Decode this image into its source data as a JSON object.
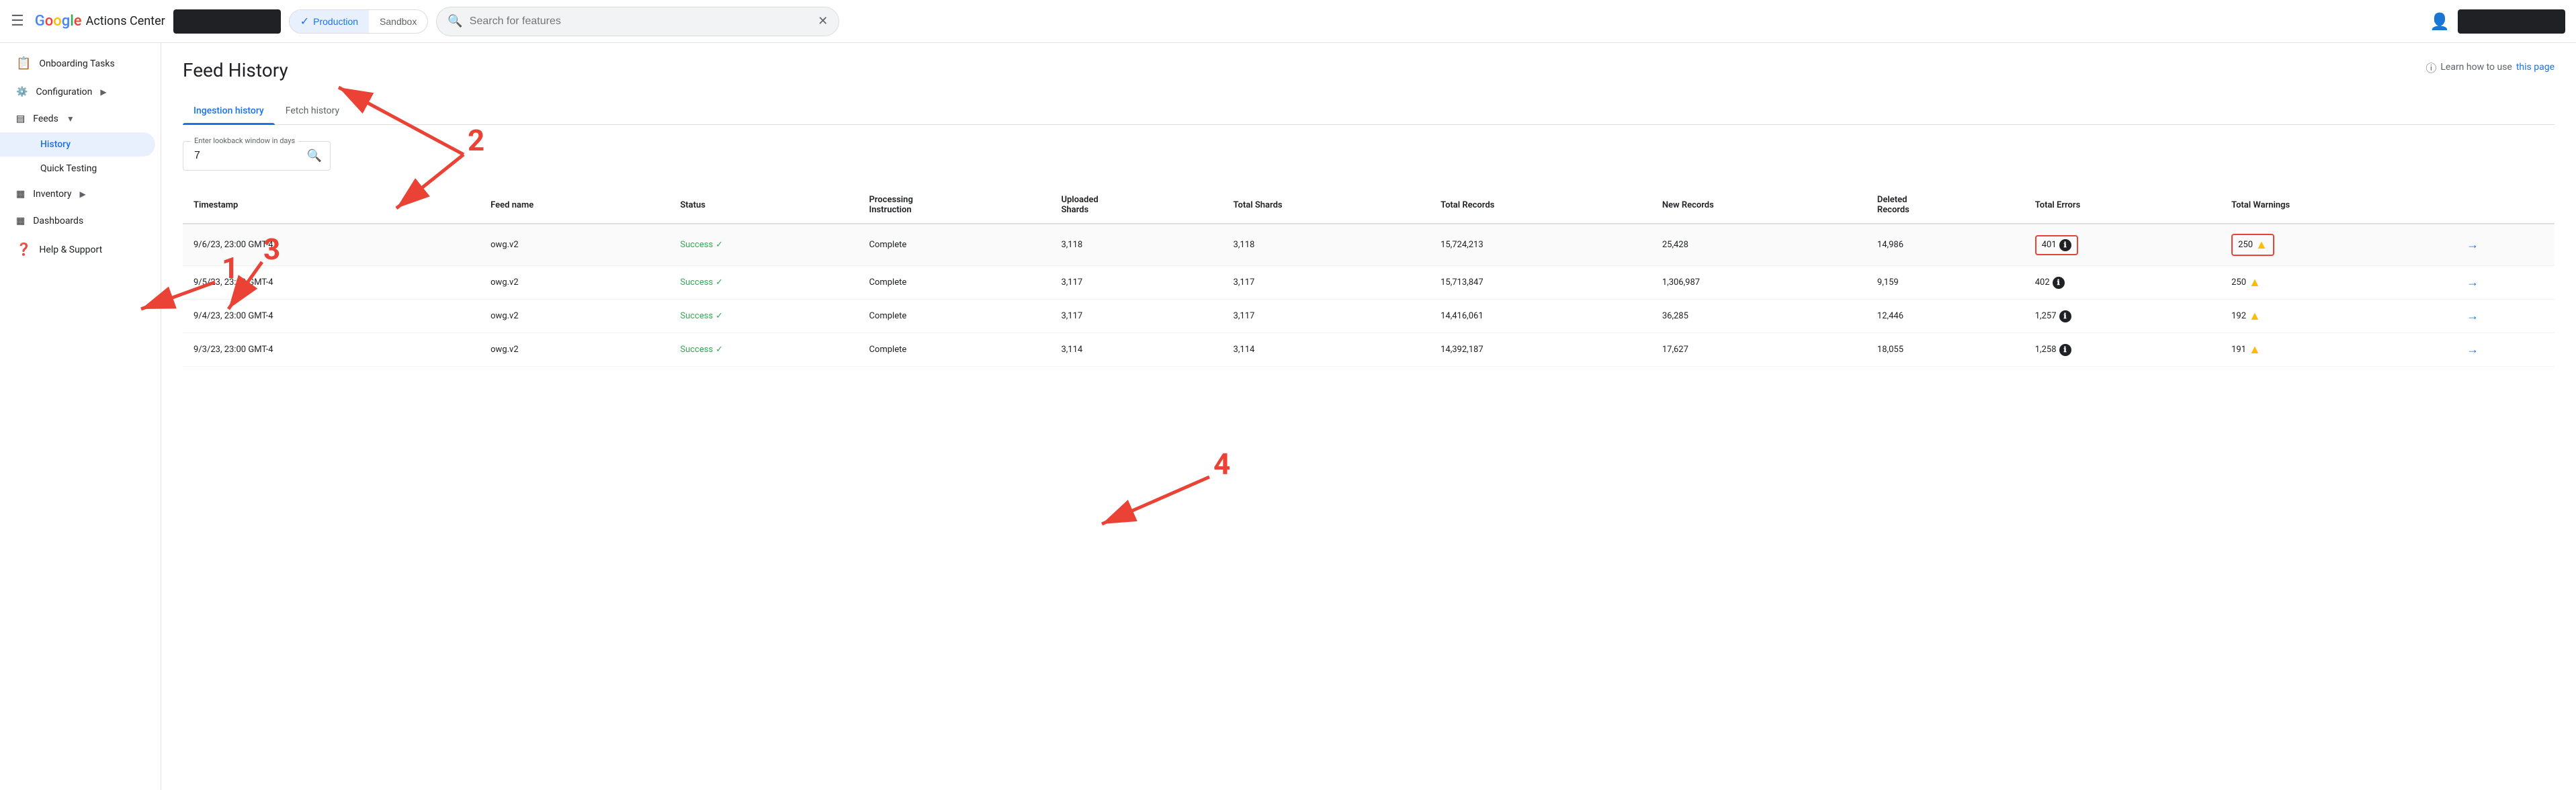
{
  "topnav": {
    "menu_icon": "☰",
    "logo_text": "Google",
    "app_name": "Actions Center",
    "env_production": "Production",
    "env_sandbox": "Sandbox",
    "search_placeholder": "Search for features",
    "search_value": ""
  },
  "sidebar": {
    "items": [
      {
        "id": "onboarding",
        "label": "Onboarding Tasks",
        "icon": "📋",
        "expandable": false
      },
      {
        "id": "configuration",
        "label": "Configuration",
        "icon": "⚙️",
        "expandable": true
      },
      {
        "id": "feeds",
        "label": "Feeds",
        "icon": "▦",
        "expandable": true,
        "expanded": true
      },
      {
        "id": "history",
        "label": "History",
        "sub": true,
        "active": true
      },
      {
        "id": "quick-testing",
        "label": "Quick Testing",
        "sub": true
      },
      {
        "id": "inventory",
        "label": "Inventory",
        "icon": "▦",
        "expandable": true
      },
      {
        "id": "dashboards",
        "label": "Dashboards",
        "icon": "▦",
        "expandable": false
      },
      {
        "id": "help-support",
        "label": "Help & Support",
        "icon": "❓",
        "expandable": false
      }
    ]
  },
  "page": {
    "title": "Feed History",
    "help_text": "Learn how to use",
    "help_link": "this page",
    "help_icon": "ⓘ"
  },
  "tabs": [
    {
      "id": "ingestion",
      "label": "Ingestion history",
      "active": true
    },
    {
      "id": "fetch",
      "label": "Fetch history",
      "active": false
    }
  ],
  "filter": {
    "lookback_label": "Enter lookback window in days",
    "lookback_value": "7"
  },
  "table": {
    "columns": [
      "Timestamp",
      "Feed name",
      "Status",
      "Processing Instruction",
      "Uploaded Shards",
      "Total Shards",
      "Total Records",
      "New Records",
      "Deleted Records",
      "Total Errors",
      "Total Warnings"
    ],
    "rows": [
      {
        "timestamp": "9/6/23, 23:00 GMT-4",
        "feed_name": "owg.v2",
        "status": "Success",
        "processing": "Complete",
        "uploaded_shards": "3,118",
        "total_shards": "3,118",
        "total_records": "15,724,213",
        "new_records": "25,428",
        "deleted_records": "14,986",
        "total_errors": "401",
        "total_warnings": "250",
        "highlight": true
      },
      {
        "timestamp": "9/5/23, 23:00 GMT-4",
        "feed_name": "owg.v2",
        "status": "Success",
        "processing": "Complete",
        "uploaded_shards": "3,117",
        "total_shards": "3,117",
        "total_records": "15,713,847",
        "new_records": "1,306,987",
        "deleted_records": "9,159",
        "total_errors": "402",
        "total_warnings": "250",
        "highlight": false
      },
      {
        "timestamp": "9/4/23, 23:00 GMT-4",
        "feed_name": "owg.v2",
        "status": "Success",
        "processing": "Complete",
        "uploaded_shards": "3,117",
        "total_shards": "3,117",
        "total_records": "14,416,061",
        "new_records": "36,285",
        "deleted_records": "12,446",
        "total_errors": "1,257",
        "total_warnings": "192",
        "highlight": false
      },
      {
        "timestamp": "9/3/23, 23:00 GMT-4",
        "feed_name": "owg.v2",
        "status": "Success",
        "processing": "Complete",
        "uploaded_shards": "3,114",
        "total_shards": "3,114",
        "total_records": "14,392,187",
        "new_records": "17,627",
        "deleted_records": "18,055",
        "total_errors": "1,258",
        "total_warnings": "191",
        "highlight": false
      }
    ]
  },
  "annotations": {
    "a1": "1",
    "a2": "2",
    "a3": "3",
    "a4": "4"
  }
}
